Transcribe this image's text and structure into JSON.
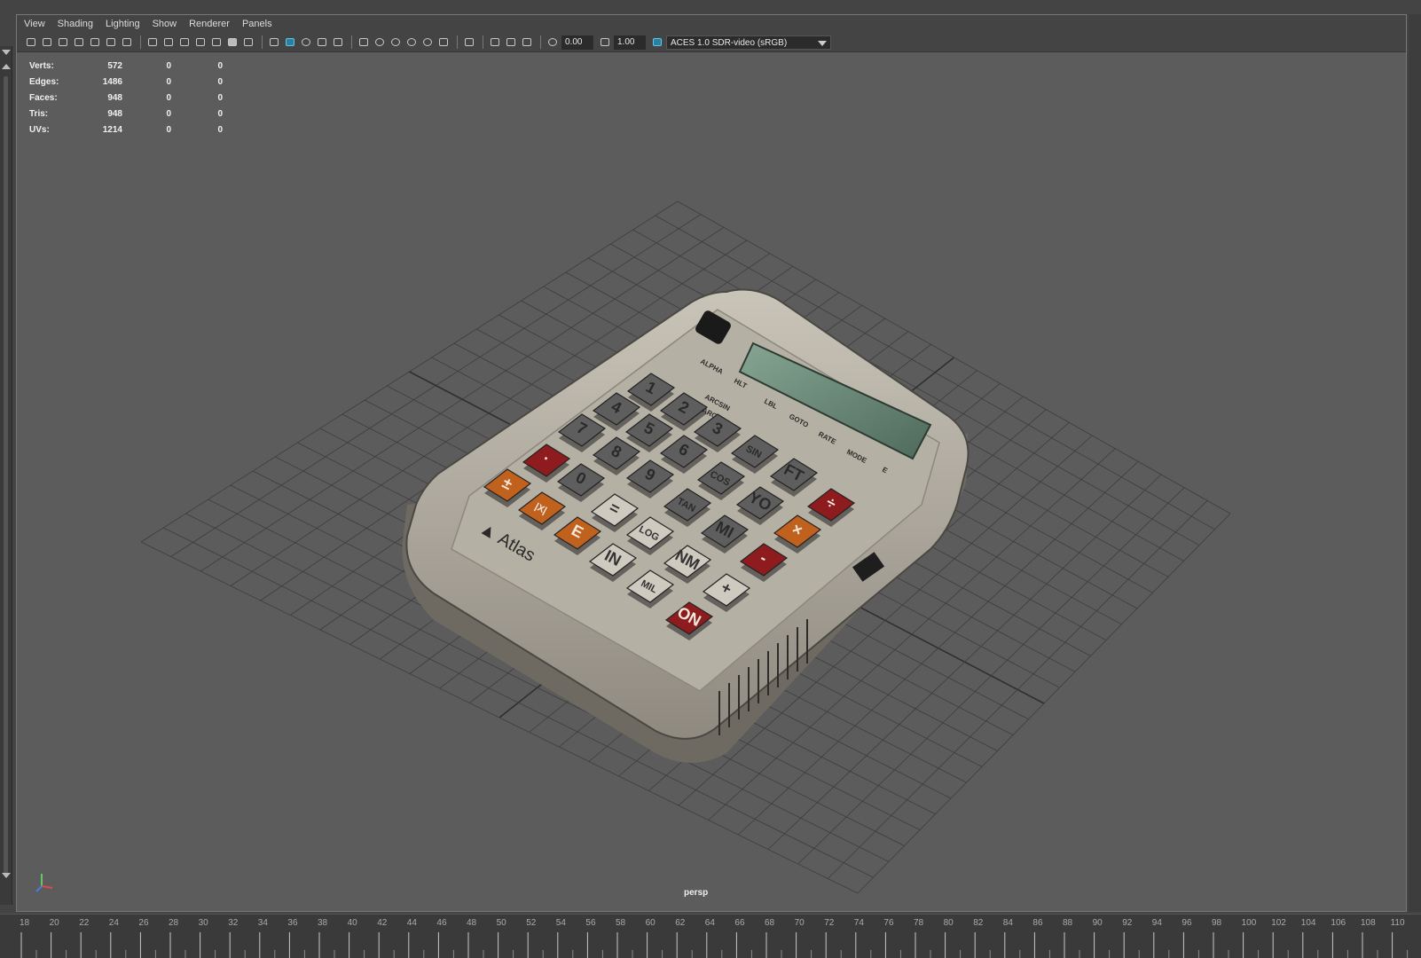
{
  "menu": [
    "View",
    "Shading",
    "Lighting",
    "Show",
    "Renderer",
    "Panels"
  ],
  "toolbar": {
    "exposure_value": "0.00",
    "gamma_value": "1.00",
    "color_space": "ACES 1.0 SDR-video (sRGB)",
    "icons": [
      "camera-icon",
      "camera-attributes-icon",
      "camera-lock-icon",
      "bookmark-icon",
      "image-plane-icon",
      "2d-pan-icon",
      "grease-pencil-icon",
      "grid-icon",
      "film-gate-icon",
      "resolution-gate-icon",
      "gate-mask-icon",
      "field-chart-icon",
      "safe-action-icon",
      "safe-title-icon",
      "wireframe-icon",
      "smooth-shade-icon",
      "default-material-icon",
      "wireframe-on-shaded-icon",
      "xray-icon",
      "use-all-lights-icon",
      "shadows-icon",
      "screen-space-ao-icon",
      "motion-blur-icon",
      "multisample-aa-icon",
      "depth-of-field-icon",
      "isolate-select-icon",
      "xray-joints-icon",
      "xray-active-icon",
      "backface-culling-icon",
      "exposure-icon",
      "gamma-icon",
      "color-management-icon"
    ]
  },
  "hud": {
    "rows": [
      {
        "label": "Verts:",
        "values": [
          "572",
          "0",
          "0"
        ]
      },
      {
        "label": "Edges:",
        "values": [
          "1486",
          "0",
          "0"
        ]
      },
      {
        "label": "Faces:",
        "values": [
          "948",
          "0",
          "0"
        ]
      },
      {
        "label": "Tris:",
        "values": [
          "948",
          "0",
          "0"
        ]
      },
      {
        "label": "UVs:",
        "values": [
          "1214",
          "0",
          "0"
        ]
      }
    ]
  },
  "camera_label": "persp",
  "model": {
    "brand": "Atlas",
    "keys": [
      "1",
      "2",
      "3",
      "4",
      "5",
      "6",
      "7",
      "8",
      "9",
      "0",
      "·",
      "±",
      "|X|",
      "E",
      "=",
      "LOG",
      "IN",
      "MIL",
      "NM",
      "ON",
      "+",
      "-",
      "TAN",
      "MI",
      "COS",
      "YO",
      "SIN",
      "FT",
      "÷",
      "×"
    ],
    "panel_labels": [
      "ALPHA",
      "HLT",
      "ARCSIN",
      "ARCCOS",
      "LBL",
      "GOTO",
      "RATE",
      "MODE",
      "E"
    ]
  },
  "timeline": {
    "ticks": [
      "18",
      "20",
      "22",
      "24",
      "26",
      "28",
      "30",
      "32",
      "34",
      "36",
      "38",
      "40",
      "42",
      "44",
      "46",
      "48",
      "50",
      "52",
      "54",
      "56",
      "58",
      "60",
      "62",
      "64",
      "66",
      "68",
      "70",
      "72",
      "74",
      "76",
      "78",
      "80",
      "82",
      "84",
      "86",
      "88",
      "90",
      "92",
      "94",
      "96",
      "98",
      "100",
      "102",
      "104",
      "106",
      "108",
      "110"
    ]
  },
  "colors": {
    "viewport_bg": "#5c5c5c",
    "grid_line": "#3d3d3d",
    "accent_blue": "#5ec8e6",
    "key_red": "#8e1c1f",
    "key_orange": "#c0611e",
    "key_gray": "#5e5e5e",
    "key_white": "#cfcac0",
    "body": "#b8b3a7",
    "lcd": "#6f8f7c"
  }
}
